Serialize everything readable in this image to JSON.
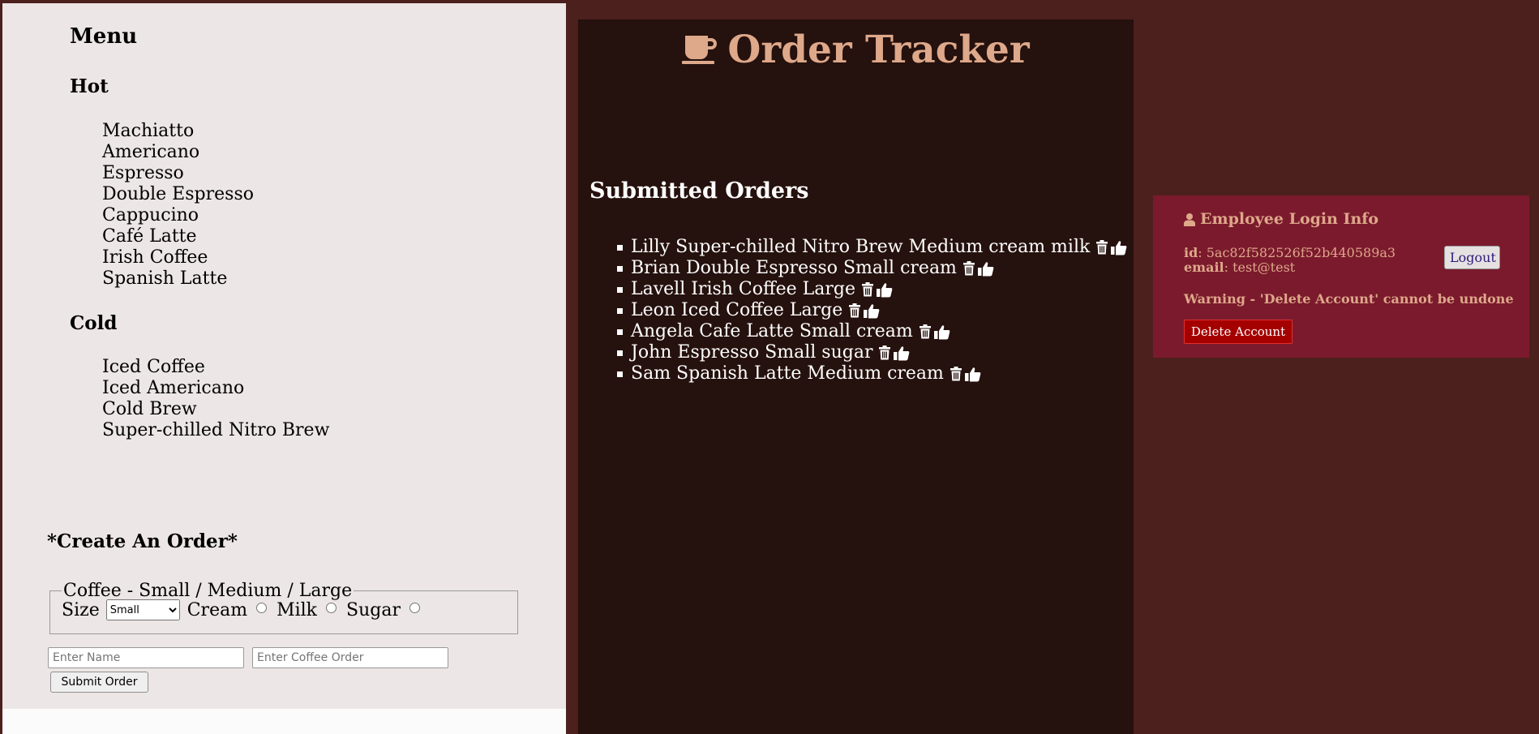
{
  "menu": {
    "title": "Menu",
    "hot_title": "Hot",
    "hot_items": [
      "Machiatto",
      "Americano",
      "Espresso",
      "Double Espresso",
      "Cappucino",
      "Café Latte",
      "Irish Coffee",
      "Spanish Latte"
    ],
    "cold_title": "Cold",
    "cold_items": [
      "Iced Coffee",
      "Iced Americano",
      "Cold Brew",
      "Super-chilled Nitro Brew"
    ]
  },
  "create_order": {
    "title": "*Create An Order*",
    "legend": "Coffee - Small / Medium / Large",
    "size_label": "Size",
    "size_selected": "Small",
    "cream_label": "Cream",
    "milk_label": "Milk",
    "sugar_label": "Sugar",
    "name_placeholder": "Enter Name",
    "coffee_placeholder": "Enter Coffee Order",
    "submit_label": "Submit Order"
  },
  "tracker": {
    "title": "Order Tracker",
    "title_icon": "coffee-cup-icon",
    "orders_title": "Submitted Orders",
    "orders": [
      "Lilly Super-chilled Nitro Brew Medium cream milk",
      "Brian Double Espresso Small cream",
      "Lavell Irish Coffee Large",
      "Leon Iced Coffee Large",
      "Angela Cafe Latte Small cream",
      "John Espresso Small sugar",
      "Sam Spanish Latte Medium cream"
    ],
    "order_icons": [
      "trash-icon",
      "thumbs-up-icon"
    ]
  },
  "employee": {
    "title": "Employee Login Info",
    "title_icon": "user-icon",
    "id_label": "id",
    "id_value": "5ac82f582526f52b440589a3",
    "email_label": "email",
    "email_value": "test@test",
    "logout_label": "Logout",
    "warning": "Warning - 'Delete Account' cannot be undone",
    "delete_label": "Delete Account"
  },
  "colors": {
    "page_bg": "#4c201d",
    "menu_bg": "#ede6e6",
    "tracker_bg": "#25110d",
    "accent": "#dea88a",
    "employee_bg": "#7b1a2d",
    "delete_bg": "#a50000"
  }
}
